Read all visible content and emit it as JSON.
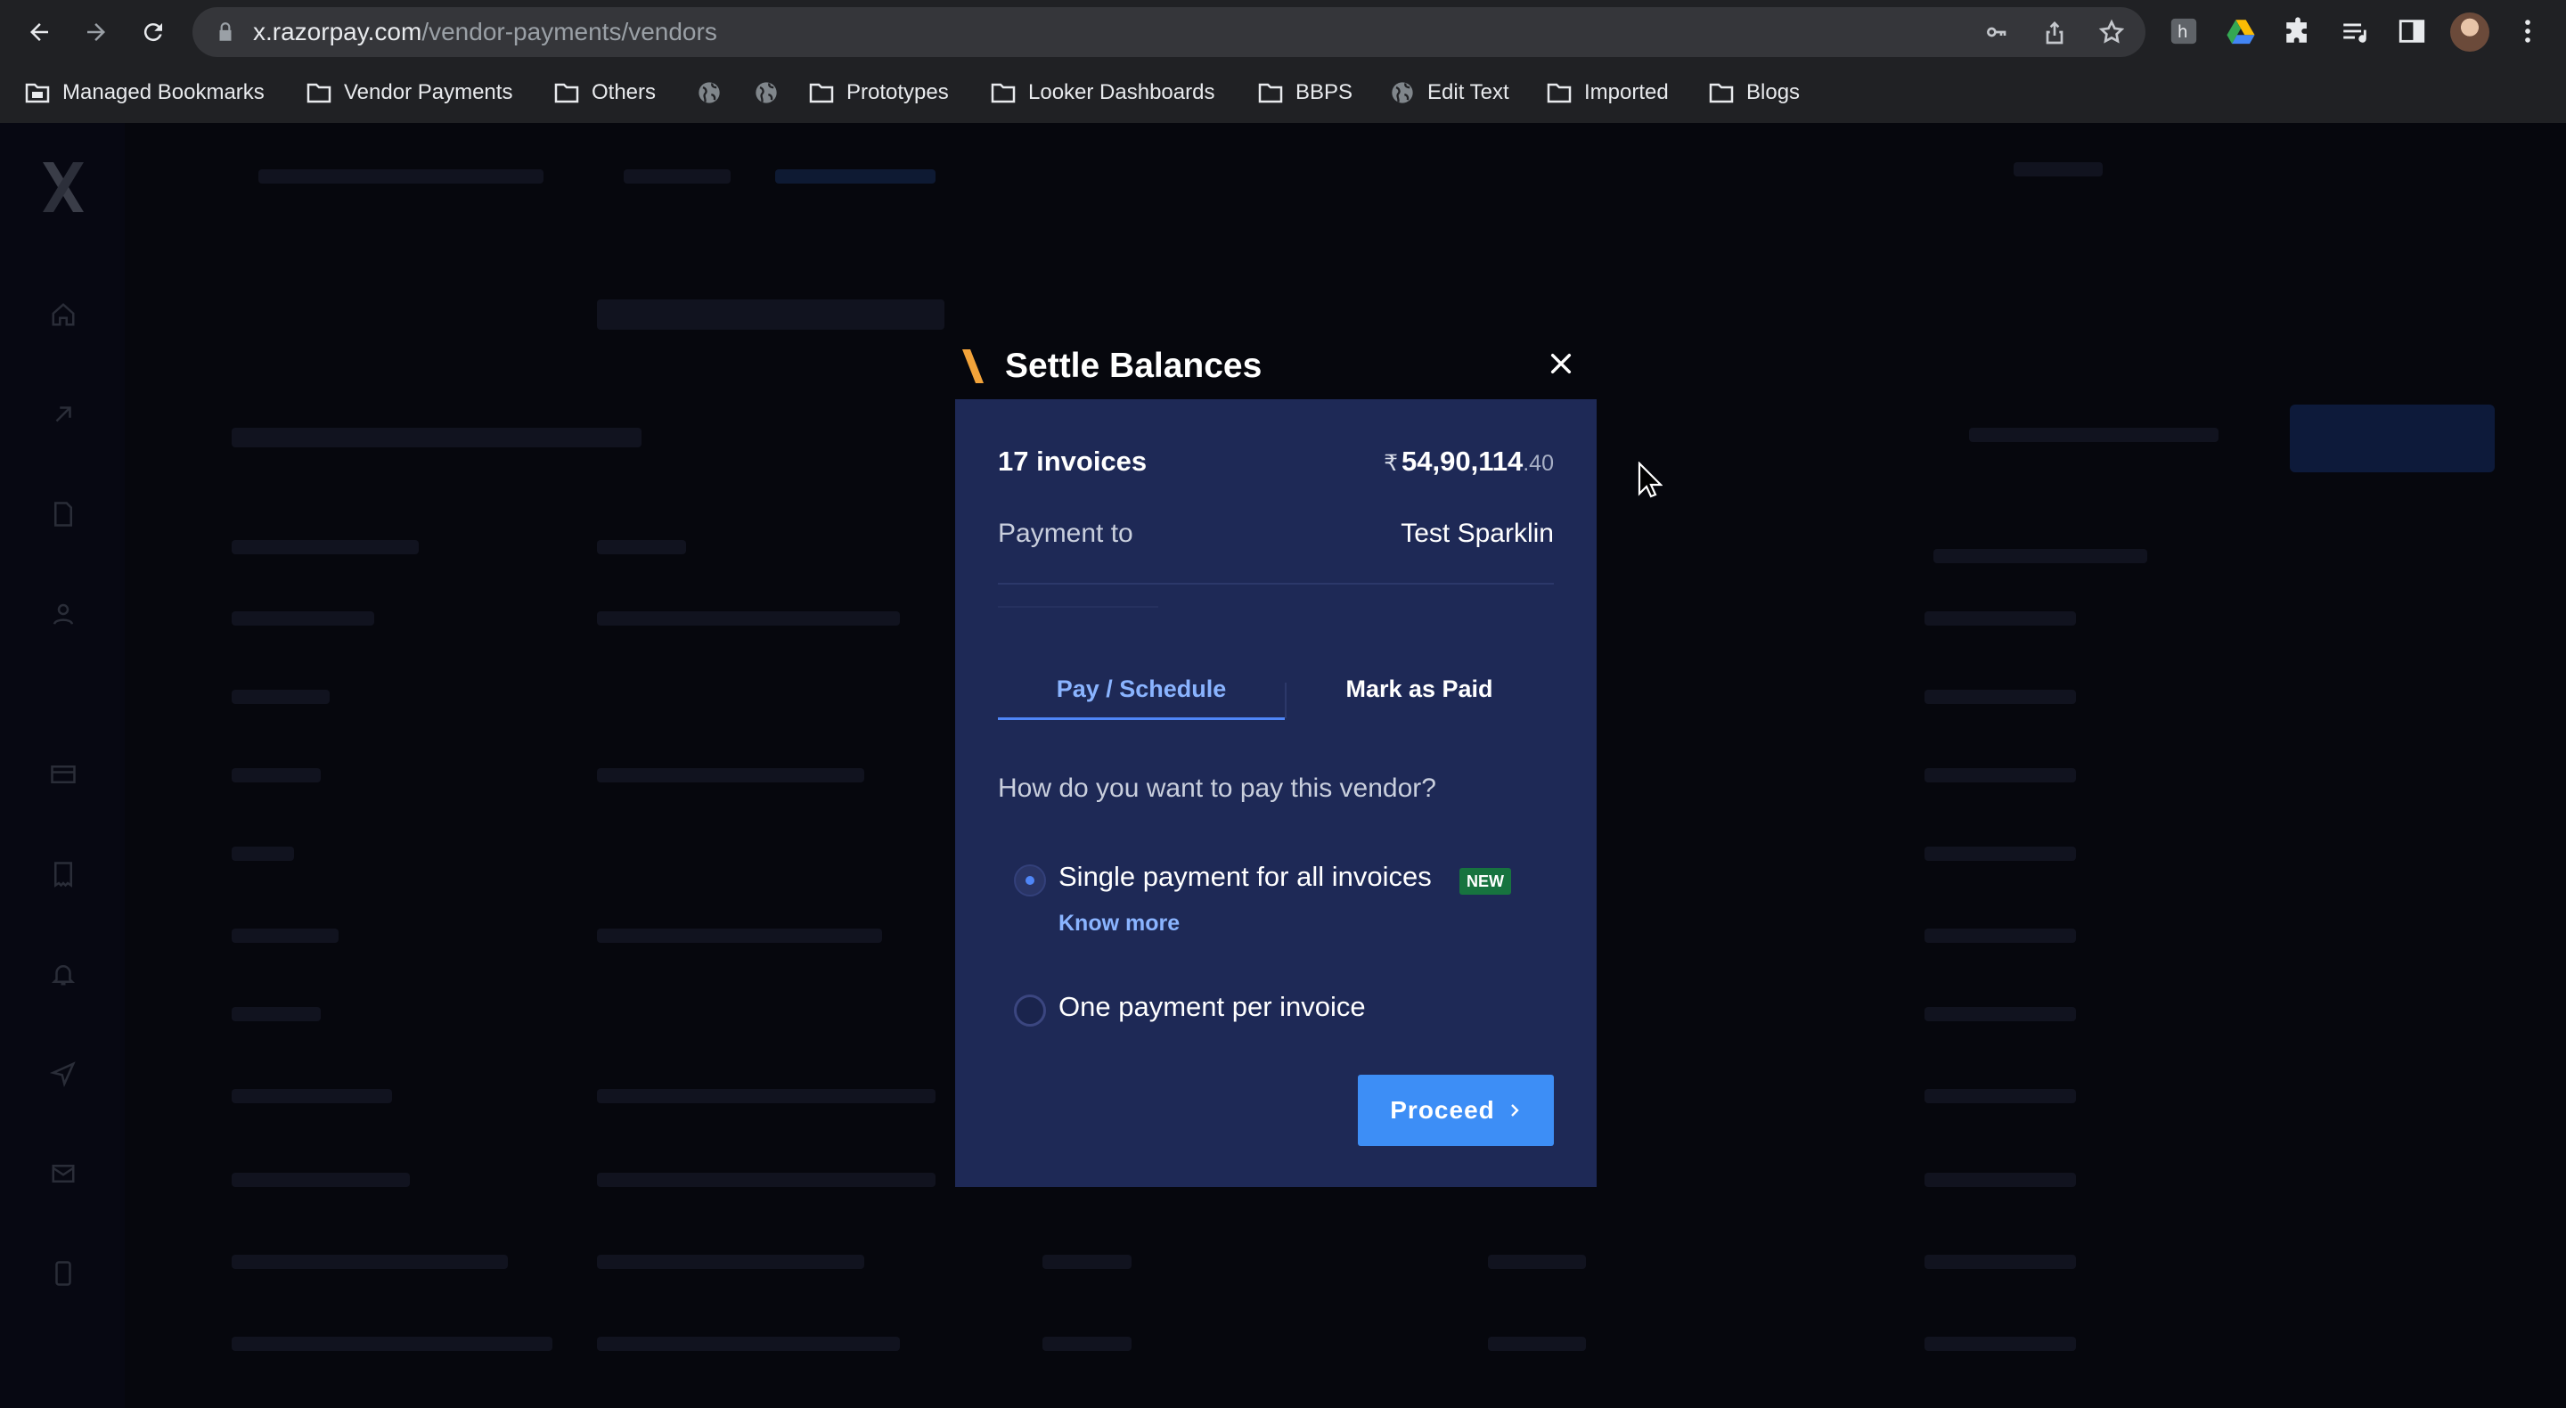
{
  "browser": {
    "url_host": "x.razorpay.com",
    "url_path": "/vendor-payments/vendors",
    "bookmarks": [
      {
        "label": "Managed Bookmarks",
        "icon": "managed-folder-icon"
      },
      {
        "label": "Vendor Payments",
        "icon": "folder-icon"
      },
      {
        "label": "Others",
        "icon": "folder-icon"
      },
      {
        "label": "",
        "icon": "globe-icon"
      },
      {
        "label": "",
        "icon": "globe-icon"
      },
      {
        "label": "Prototypes",
        "icon": "folder-icon"
      },
      {
        "label": "Looker Dashboards",
        "icon": "folder-icon"
      },
      {
        "label": "BBPS",
        "icon": "folder-icon"
      },
      {
        "label": "Edit Text",
        "icon": "globe-icon"
      },
      {
        "label": "Imported",
        "icon": "folder-icon"
      },
      {
        "label": "Blogs",
        "icon": "folder-icon"
      }
    ]
  },
  "modal": {
    "title": "Settle Balances",
    "invoice_count": "17 invoices",
    "amount_symbol": "₹",
    "amount_main": "54,90,114",
    "amount_paise": ".40",
    "payment_to_label": "Payment to",
    "vendor_name": "Test Sparklin",
    "tabs": [
      {
        "label": "Pay / Schedule",
        "active": true
      },
      {
        "label": "Mark as Paid",
        "active": false
      }
    ],
    "question": "How do you want to pay this vendor?",
    "options": [
      {
        "label": "Single payment for all invoices",
        "selected": true,
        "badge": "NEW",
        "link": "Know more"
      },
      {
        "label": "One payment per invoice",
        "selected": false
      }
    ],
    "proceed_label": "Proceed"
  },
  "colors": {
    "modal_bg": "#1e2956",
    "accent_blue": "#3d8ef6",
    "link_blue": "#8ab4ff",
    "badge_green": "#17733f",
    "title_accent": "#f2a33a"
  }
}
